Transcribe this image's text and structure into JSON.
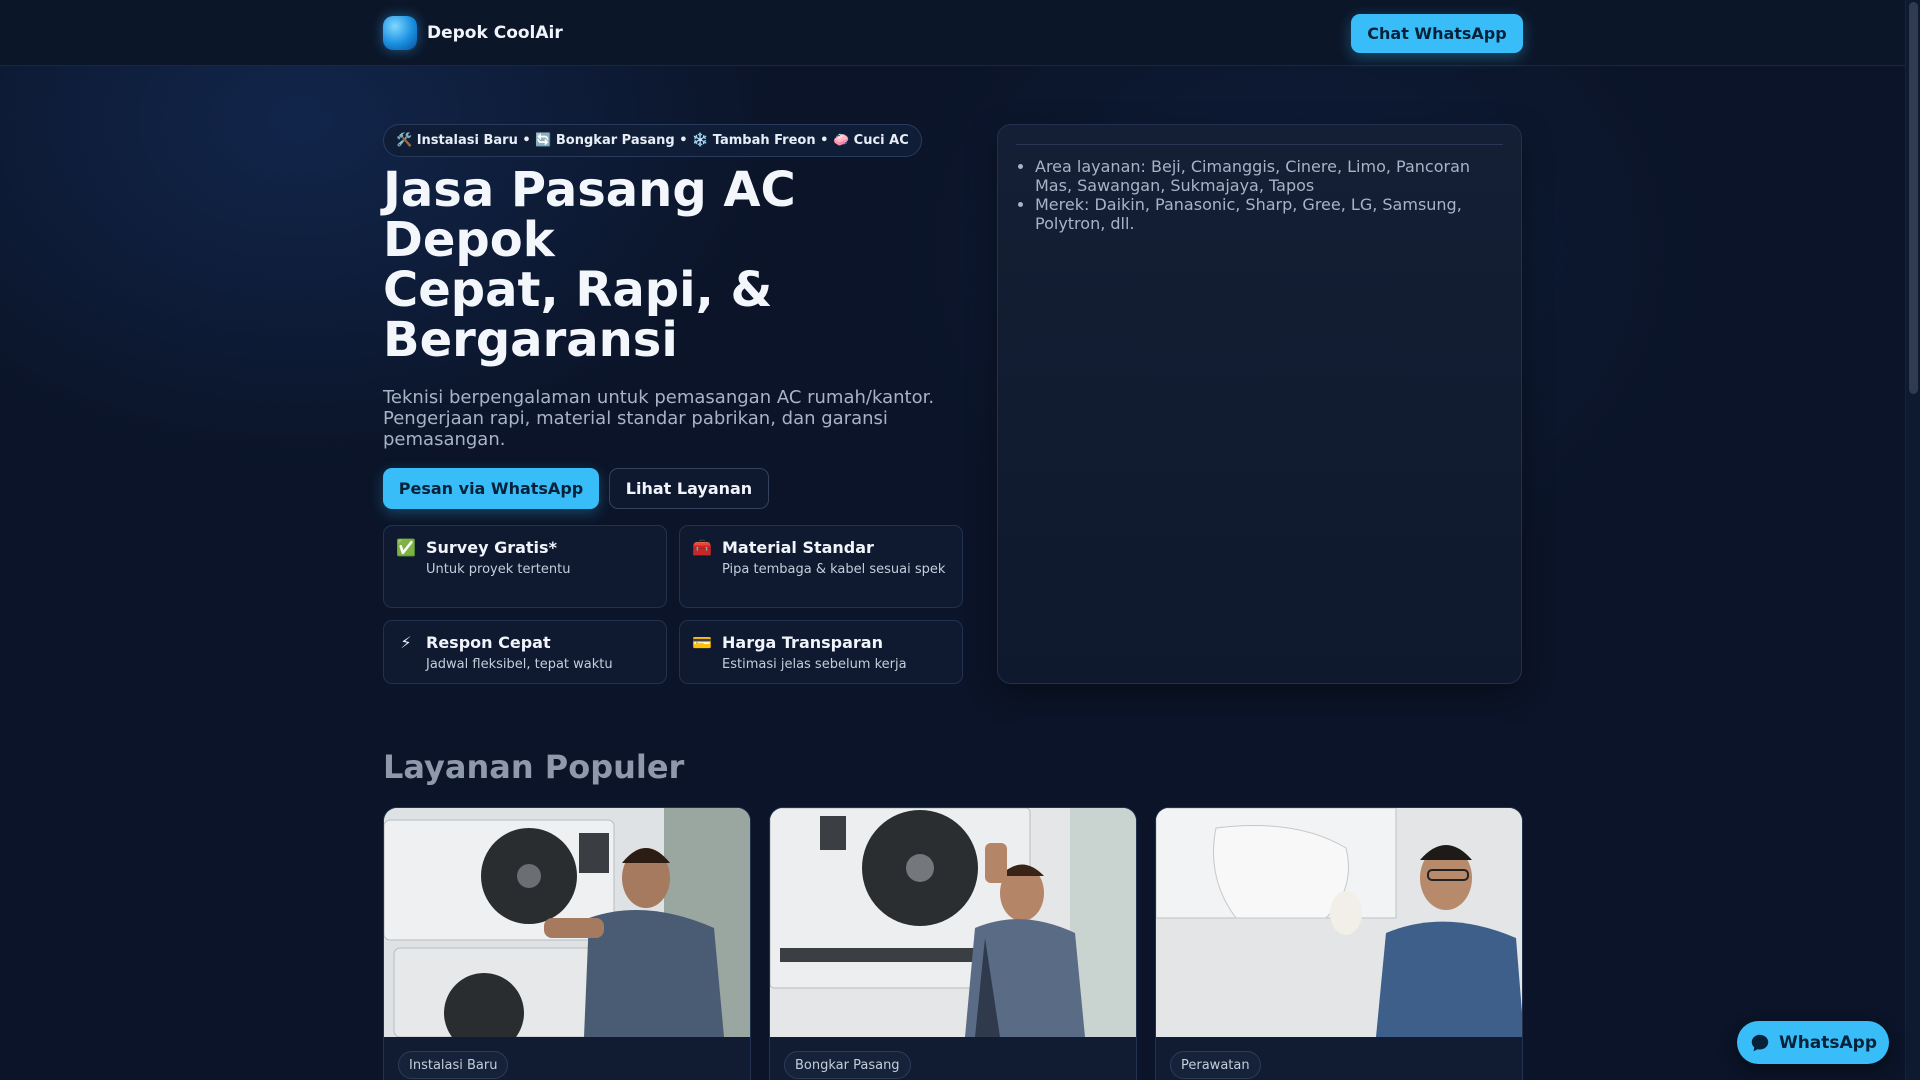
{
  "header": {
    "brand": "Depok CoolAir",
    "cta_label": "Chat WhatsApp"
  },
  "hero": {
    "pill_text": "🛠️ Instalasi Baru • 🔄 Bongkar Pasang • ❄️ Tambah Freon • 🧼 Cuci AC",
    "title_lines": [
      "Jasa Pasang AC",
      "Depok",
      "Cepat, Rapi, &",
      "Bergaransi"
    ],
    "subtitle": "Teknisi berpengalaman untuk pemasangan AC rumah/kantor. Pengerjaan rapi, material standar pabrikan, dan garansi pemasangan.",
    "primary_btn": "Pesan via WhatsApp",
    "secondary_btn": "Lihat Layanan",
    "features": [
      {
        "icon": "✅",
        "title": "Survey Gratis*",
        "desc": "Untuk proyek tertentu"
      },
      {
        "icon": "🧰",
        "title": "Material Standar",
        "desc": "Pipa tembaga & kabel sesuai spek"
      },
      {
        "icon": "⚡",
        "title": "Respon Cepat",
        "desc": "Jadwal fleksibel, tepat waktu"
      },
      {
        "icon": "💳",
        "title": "Harga Transparan",
        "desc": "Estimasi jelas sebelum kerja"
      }
    ]
  },
  "info_card": {
    "items": [
      "Area layanan: Beji, Cimanggis, Cinere, Limo, Pancoran Mas, Sawangan, Sukmajaya, Tapos",
      "Merek: Daikin, Panasonic, Sharp, Gree, LG, Samsung, Polytron, dll."
    ]
  },
  "services": {
    "title": "Layanan Populer",
    "cards": [
      {
        "tag": "Instalasi Baru",
        "image": "technician-installing-ac-photo"
      },
      {
        "tag": "Bongkar Pasang",
        "image": "technician-removing-ac-unit-photo"
      },
      {
        "tag": "Perawatan",
        "image": "technician-cleaning-ac-photo"
      }
    ]
  },
  "fab": {
    "label": "WhatsApp",
    "icon": "chat-bubble-icon"
  },
  "colors": {
    "accent": "#38bdf8",
    "background": "#0b1428"
  }
}
